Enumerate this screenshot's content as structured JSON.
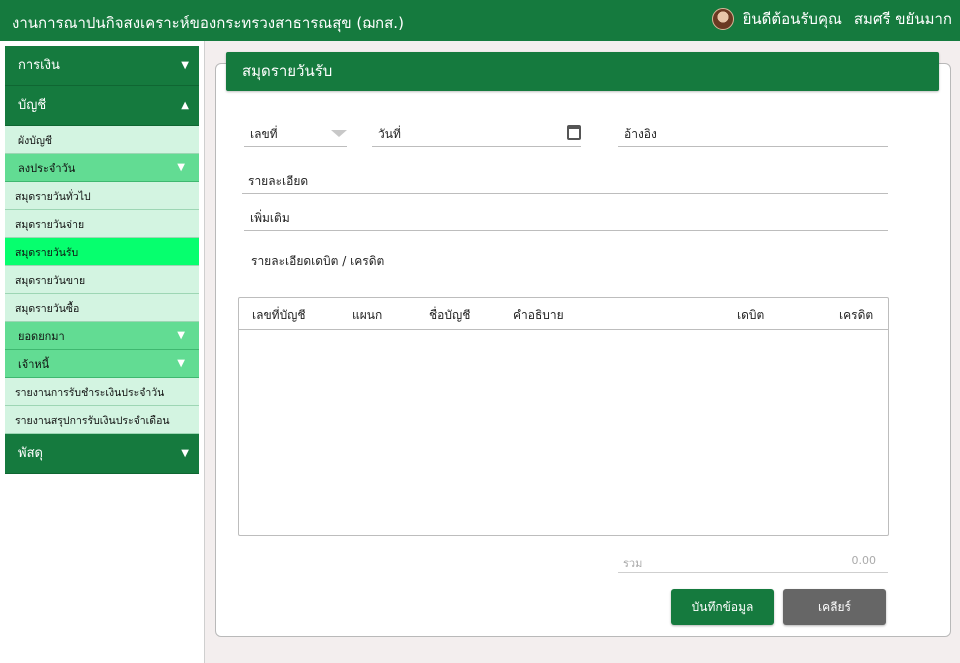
{
  "header": {
    "app_title": "งานการณาปนกิจสงเคราะห์ของกระทรวงสาธารณสุข (ฌกส.)",
    "welcome": "ยินดีต้อนรับคุณ",
    "user_name": "สมศรี ขยันมาก"
  },
  "sidebar": {
    "finance": "การเงิน",
    "accounting": "บัญชี",
    "chart_of_accounts": "ผังบัญชี",
    "daily_entry": "ลงประจำวัน",
    "journal_general": "สมุดรายวันทั่วไป",
    "journal_payment": "สมุดรายวันจ่าย",
    "journal_receipt": "สมุดรายวันรับ",
    "journal_sales": "สมุดรายวันขาย",
    "journal_purchase": "สมุดรายวันซื้อ",
    "balance_forward": "ยอดยกมา",
    "creditor": "เจ้าหนี้",
    "report_daily_receipt": "รายงานการรับชำระเงินประจำวัน",
    "report_monthly_receipt": "รายงานสรุปการรับเงินประจำเดือน",
    "supplies": "พัสดุ"
  },
  "form": {
    "title": "สมุดรายวันรับ",
    "doc_no_placeholder": "เลขที่",
    "date_placeholder": "วันที่",
    "reference_placeholder": "อ้างอิง",
    "detail_placeholder": "รายละเอียด",
    "additional_placeholder": "เพิ่มเติม",
    "debit_credit_section": "รายละเอียดเดบิต / เครดิต"
  },
  "table": {
    "columns": [
      "เลขที่บัญชี",
      "แผนก",
      "ชื่อบัญชี",
      "คำอธิบาย",
      "เดบิต",
      "เครดิต"
    ],
    "rows": []
  },
  "total": {
    "label": "รวม",
    "value": "0.00"
  },
  "buttons": {
    "save": "บันทึกข้อมูล",
    "clear": "เคลียร์"
  },
  "colors": {
    "primary": "#157a3e",
    "submenu": "#62dc93",
    "leaf": "#d3f4e1",
    "active": "#06ff6e",
    "clear_button": "#666666"
  },
  "icons": {
    "expand": "chevron-down-icon",
    "collapse": "chevron-up-icon",
    "calendar": "calendar-icon"
  }
}
